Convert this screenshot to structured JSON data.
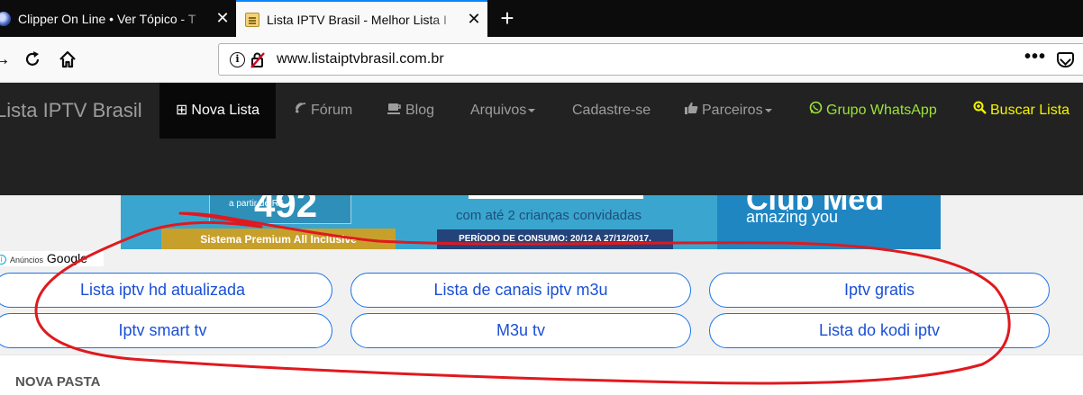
{
  "browser": {
    "tabs": [
      {
        "title": "Clipper On Line • Ver Tópico - T"
      },
      {
        "title": "Lista IPTV Brasil - Melhor Lista I"
      }
    ],
    "url": "www.listaiptvbrasil.com.br"
  },
  "site_nav": {
    "brand": "Lista IPTV Brasil",
    "items": [
      {
        "label": "Nova Lista"
      },
      {
        "label": "Fórum"
      },
      {
        "label": "Blog"
      },
      {
        "label": "Arquivos"
      },
      {
        "label": "Cadastre-se"
      },
      {
        "label": "Parceiros"
      },
      {
        "label": "Grupo WhatsApp"
      },
      {
        "label": "Buscar Lista"
      }
    ]
  },
  "banner": {
    "currency": "a partir de R$",
    "price": "492",
    "kids_text": "com até 2 crianças convidadas",
    "system_text": "Sistema Premium All Inclusive",
    "period_text": "PERÍODO DE CONSUMO: 20/12 A 27/12/2017.",
    "brand_text": "Club Med",
    "tagline": "amazing you"
  },
  "ads": {
    "small_label": "Anúncios",
    "brand_label": "Google"
  },
  "ad_links": [
    {
      "label": "Lista iptv hd atualizada"
    },
    {
      "label": "Lista de canais iptv m3u"
    },
    {
      "label": "Iptv gratis"
    },
    {
      "label": "Iptv smart tv"
    },
    {
      "label": "M3u tv"
    },
    {
      "label": "Lista do kodi iptv"
    }
  ],
  "panel": {
    "title": "NOVA PASTA"
  },
  "colors": {
    "navbar_bg": "#222222",
    "whatsapp_green": "#9be33a",
    "search_yellow": "#f4f400",
    "pill_border": "#1a73e8",
    "annotation_red": "#e0191e"
  }
}
